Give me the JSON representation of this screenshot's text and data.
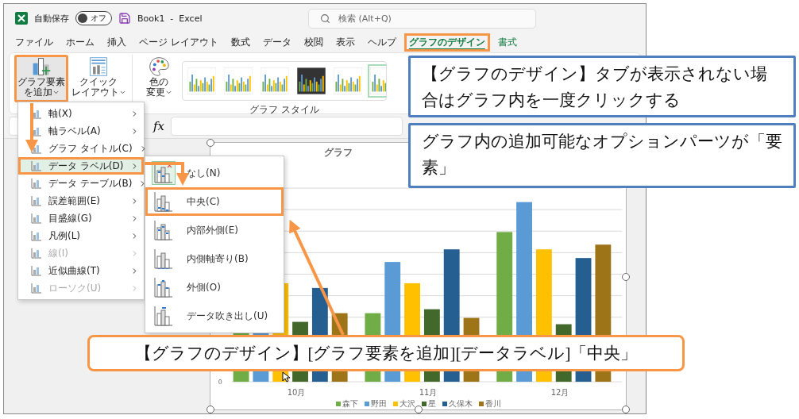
{
  "title_bar": {
    "autosave_label": "自動保存",
    "autosave": {
      "on": false,
      "label": "オフ"
    },
    "document": "Book1  -  Excel",
    "search": {
      "placeholder": "検索 (Alt+Q)"
    }
  },
  "tabs": [
    {
      "label": "ファイル",
      "kind": "standard",
      "selected": false,
      "highlighted": false
    },
    {
      "label": "ホーム",
      "kind": "standard",
      "selected": false,
      "highlighted": false
    },
    {
      "label": "挿入",
      "kind": "standard",
      "selected": false,
      "highlighted": false
    },
    {
      "label": "ページ レイアウト",
      "kind": "standard",
      "selected": false,
      "highlighted": false
    },
    {
      "label": "数式",
      "kind": "standard",
      "selected": false,
      "highlighted": false
    },
    {
      "label": "データ",
      "kind": "standard",
      "selected": false,
      "highlighted": false
    },
    {
      "label": "校閲",
      "kind": "standard",
      "selected": false,
      "highlighted": false
    },
    {
      "label": "表示",
      "kind": "standard",
      "selected": false,
      "highlighted": false
    },
    {
      "label": "ヘルプ",
      "kind": "standard",
      "selected": false,
      "highlighted": false
    },
    {
      "label": "グラフのデザイン",
      "kind": "contextual",
      "selected": true,
      "highlighted": true
    },
    {
      "label": "書式",
      "kind": "contextual",
      "selected": false,
      "highlighted": false
    }
  ],
  "ribbon": {
    "buttons": [
      {
        "kind": "add-element",
        "lines": [
          "グラフ要素",
          "を追加"
        ],
        "highlighted": true
      },
      {
        "kind": "quick-layout",
        "lines": [
          "クイック",
          "レイアウト"
        ],
        "highlighted": false
      },
      {
        "kind": "colors",
        "lines": [
          "色の",
          "変更"
        ],
        "highlighted": false
      }
    ],
    "gallery": {
      "label": "グラフ スタイル",
      "styles": [
        {
          "kind": "light",
          "selected": false
        },
        {
          "kind": "light",
          "selected": false
        },
        {
          "kind": "light",
          "selected": false
        },
        {
          "kind": "dark",
          "selected": false
        },
        {
          "kind": "light",
          "selected": false
        },
        {
          "kind": "light",
          "selected": true
        }
      ]
    }
  },
  "formula_bar": {
    "function_label": "fx"
  },
  "chart": {
    "title": "グラフ",
    "axis_label": "0",
    "categories": [
      "10月",
      "11月",
      "12月"
    ],
    "legend": [
      {
        "name": "森下",
        "color": "#70ad47"
      },
      {
        "name": "野田",
        "color": "#5b9bd5"
      },
      {
        "name": "大沢",
        "color": "#ffc000"
      },
      {
        "name": "星",
        "color": "#43682b"
      },
      {
        "name": "久保木",
        "color": "#255e91"
      },
      {
        "name": "香川",
        "color": "#9e7418"
      }
    ]
  },
  "element_menu": {
    "items": [
      {
        "label": "軸(X)",
        "selected": false,
        "disabled": false,
        "highlighted": false
      },
      {
        "label": "軸ラベル(A)",
        "selected": false,
        "disabled": false,
        "highlighted": false
      },
      {
        "label": "グラフ タイトル(C)",
        "selected": false,
        "disabled": false,
        "highlighted": false
      },
      {
        "label": "データ ラベル(D)",
        "selected": true,
        "disabled": false,
        "highlighted": true
      },
      {
        "label": "データ テーブル(B)",
        "selected": false,
        "disabled": false,
        "highlighted": false
      },
      {
        "label": "誤差範囲(E)",
        "selected": false,
        "disabled": false,
        "highlighted": false
      },
      {
        "label": "目盛線(G)",
        "selected": false,
        "disabled": false,
        "highlighted": false
      },
      {
        "label": "凡例(L)",
        "selected": false,
        "disabled": false,
        "highlighted": false
      },
      {
        "label": "線(I)",
        "selected": false,
        "disabled": true,
        "highlighted": false
      },
      {
        "label": "近似曲線(T)",
        "selected": false,
        "disabled": false,
        "highlighted": false
      },
      {
        "label": "ローソク(U)",
        "selected": false,
        "disabled": true,
        "highlighted": false
      }
    ]
  },
  "data_label_menu": {
    "items": [
      {
        "label": "なし(N)",
        "kind": "none",
        "selected": true,
        "highlighted": false
      },
      {
        "label": "中央(C)",
        "kind": "center",
        "selected": false,
        "highlighted": true
      },
      {
        "label": "内部外側(E)",
        "kind": "inside-end",
        "selected": false,
        "highlighted": false
      },
      {
        "label": "内側軸寄り(B)",
        "kind": "inside-base",
        "selected": false,
        "highlighted": false
      },
      {
        "label": "外側(O)",
        "kind": "outside-end",
        "selected": false,
        "highlighted": false
      },
      {
        "label": "データ吹き出し(U)",
        "kind": "callout",
        "selected": false,
        "highlighted": false
      }
    ]
  },
  "callouts": [
    {
      "kind": "note",
      "text": "【グラフのデザイン】タブが表示されない場合はグラフ内を一度クリックする"
    },
    {
      "kind": "note",
      "text": "グラフ内の追加可能なオプションパーツが「要素」"
    },
    {
      "kind": "instruction",
      "text": "【グラフのデザイン】[グラフ要素を追加][データラベル]「中央」"
    }
  ]
}
